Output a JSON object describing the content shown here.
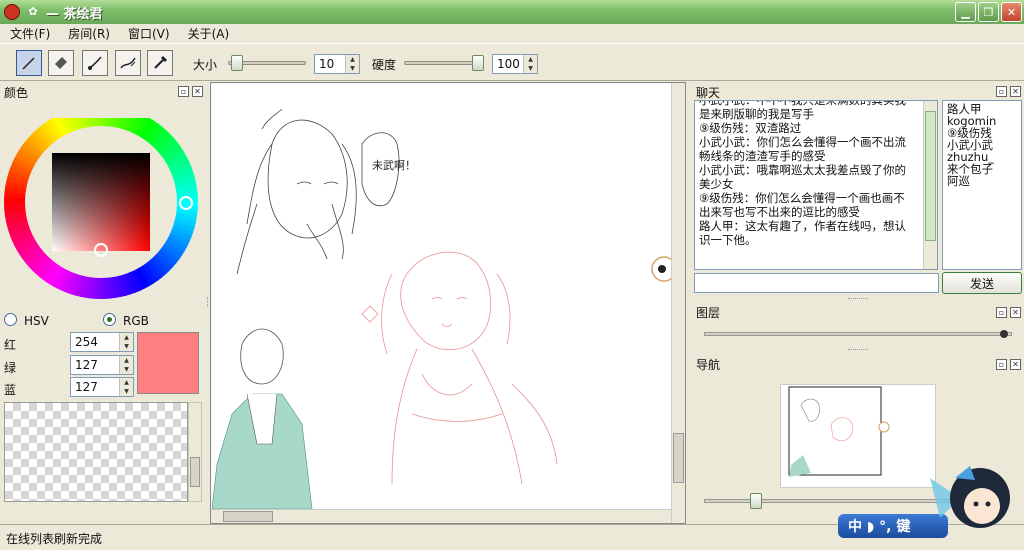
{
  "window": {
    "title": "— 茶绘君"
  },
  "menu": [
    "文件(F)",
    "房间(R)",
    "窗口(V)",
    "关于(A)"
  ],
  "toolbar": {
    "tools": [
      {
        "name": "pen-icon"
      },
      {
        "name": "eraser-icon"
      },
      {
        "name": "brush-icon"
      },
      {
        "name": "airbrush-icon"
      },
      {
        "name": "eyedropper-icon"
      }
    ],
    "size_label": "大小",
    "size_value": "10",
    "size_level": 0.05,
    "hardness_label": "硬度",
    "hardness_value": "100",
    "hardness_level": 1.0
  },
  "color_panel": {
    "title": "颜色",
    "mode_hsv": "HSV",
    "mode_rgb": "RGB",
    "selected_mode": "RGB",
    "red_label": "红",
    "green_label": "绿",
    "blue_label": "蓝",
    "red": "254",
    "green": "127",
    "blue": "127",
    "swatch_color": "#fe7f7f"
  },
  "chat_panel": {
    "title": "聊天",
    "messages": [
      "小武小武：不不不我只是来满数的其实我",
      "是来刷版聊的我是写手",
      "⑨级伤残：双渣路过",
      "小武小武：你们怎么会懂得一个画不出流",
      "畅线条的渣渣写手的感受",
      "小武小武：哦靠啊巡太太我差点毁了你的",
      "美少女",
      "⑨级伤残：你们怎么会懂得一个画也画不",
      "出来写也写不出来的逗比的感受",
      "路人甲：这太有趣了，作者在线吗，想认",
      "识一下他。"
    ],
    "users": [
      "路人甲",
      "kogomin",
      "⑨级伤残",
      "小武小武",
      "zhuzhu_",
      "来个包子",
      "阿巡"
    ],
    "input_value": "",
    "send_label": "发送"
  },
  "layers_panel": {
    "title": "图层"
  },
  "navigator_panel": {
    "title": "导航",
    "zoom_level": 0.3
  },
  "canvas": {
    "bubble_text": "未武啊！"
  },
  "status": {
    "text": "在线列表刷新完成"
  },
  "ime": {
    "text": "中 ◗ °, 键"
  }
}
